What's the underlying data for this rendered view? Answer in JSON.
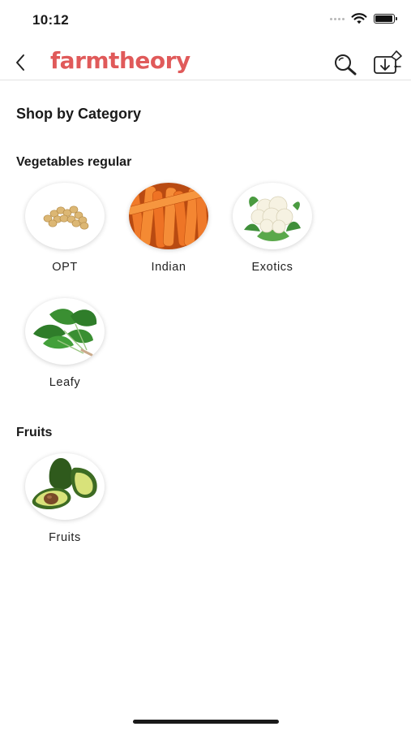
{
  "status_bar": {
    "time": "10:12",
    "battery_level": 0.95
  },
  "header": {
    "logo_text": "farmtheory",
    "brand_color": "#e05a5a",
    "back_icon": "chevron-left-icon",
    "search_icon": "search-icon",
    "download_icon": "download-icon"
  },
  "page": {
    "title": "Shop by Category"
  },
  "sections": [
    {
      "title": "Vegetables regular",
      "items": [
        {
          "label": "OPT",
          "icon": "chickpeas-image"
        },
        {
          "label": "Indian",
          "icon": "carrots-image"
        },
        {
          "label": "Exotics",
          "icon": "cauliflower-image"
        },
        {
          "label": "Leafy",
          "icon": "spinach-image"
        }
      ]
    },
    {
      "title": "Fruits",
      "items": [
        {
          "label": "Fruits",
          "icon": "avocado-image"
        }
      ]
    }
  ]
}
